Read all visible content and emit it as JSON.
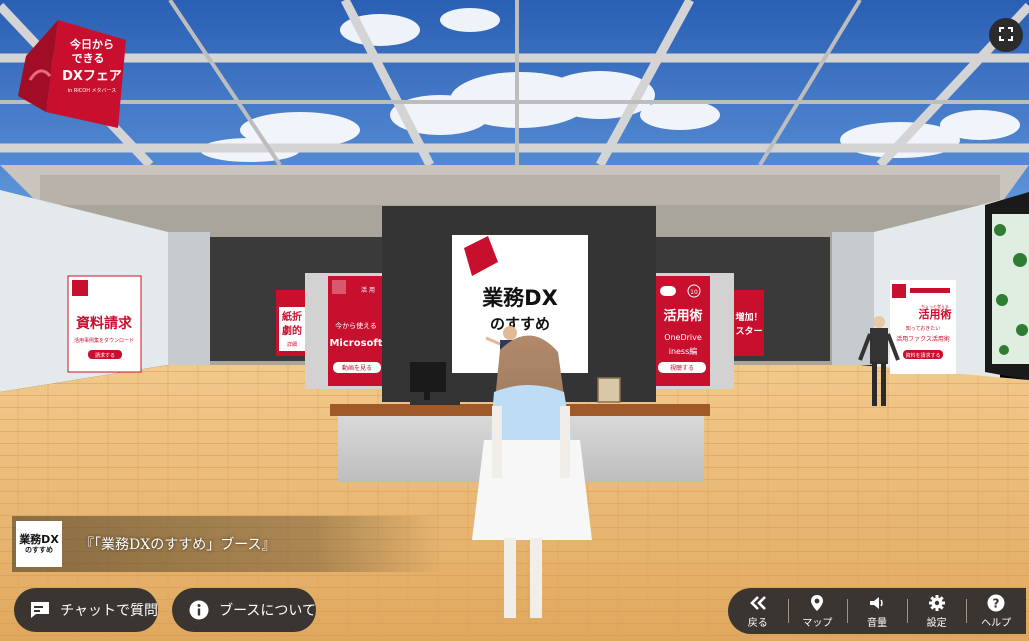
{
  "scene": {
    "fair_logo": {
      "line1": "今日から",
      "line2": "できる",
      "line3": "DXフェア",
      "line4": "in RICOH メタバース"
    },
    "main_screen": {
      "line1": "業務DX",
      "line2": "のすすめ"
    },
    "left_panel": {
      "title": "資料請求",
      "subtitle": "活用事例集をダウンロード",
      "button": "請求する"
    },
    "left_mid_panel": {
      "title": "紙折",
      "title2": "劇的",
      "button": "詳細"
    },
    "center_left_panel": {
      "header": "活 用",
      "title": "今から使える",
      "title2": "Microsoft",
      "button": "動画を見る"
    },
    "center_right_panel": {
      "badge": "10",
      "title": "活用術",
      "title2": "OneDrive",
      "title3": "iness編",
      "button": "視聴する"
    },
    "right_mid_panel": {
      "title": "増加！",
      "title2": "スター"
    },
    "right_panel": {
      "small": "ちょっと覚える",
      "title": "活用術",
      "sub1": "知っておきたい",
      "sub2": "活用ファクス活用術",
      "button": "資料を請求する"
    }
  },
  "booth_label": {
    "logo_line1": "業務DX",
    "logo_line2": "のすすめ",
    "text": "『「業務DXのすすめ」ブース』"
  },
  "buttons": {
    "chat": "チャットで質問",
    "about": "ブースについて"
  },
  "toolbar": [
    {
      "label": "戻る",
      "icon": "back-icon"
    },
    {
      "label": "マップ",
      "icon": "map-pin-icon"
    },
    {
      "label": "音量",
      "icon": "volume-icon"
    },
    {
      "label": "設定",
      "icon": "gear-icon"
    },
    {
      "label": "ヘルプ",
      "icon": "help-icon"
    }
  ],
  "colors": {
    "brand_red": "#c8102e",
    "hud_bg": "#3a3530",
    "floor": "#e9b873",
    "sky": "#3f78c8"
  }
}
